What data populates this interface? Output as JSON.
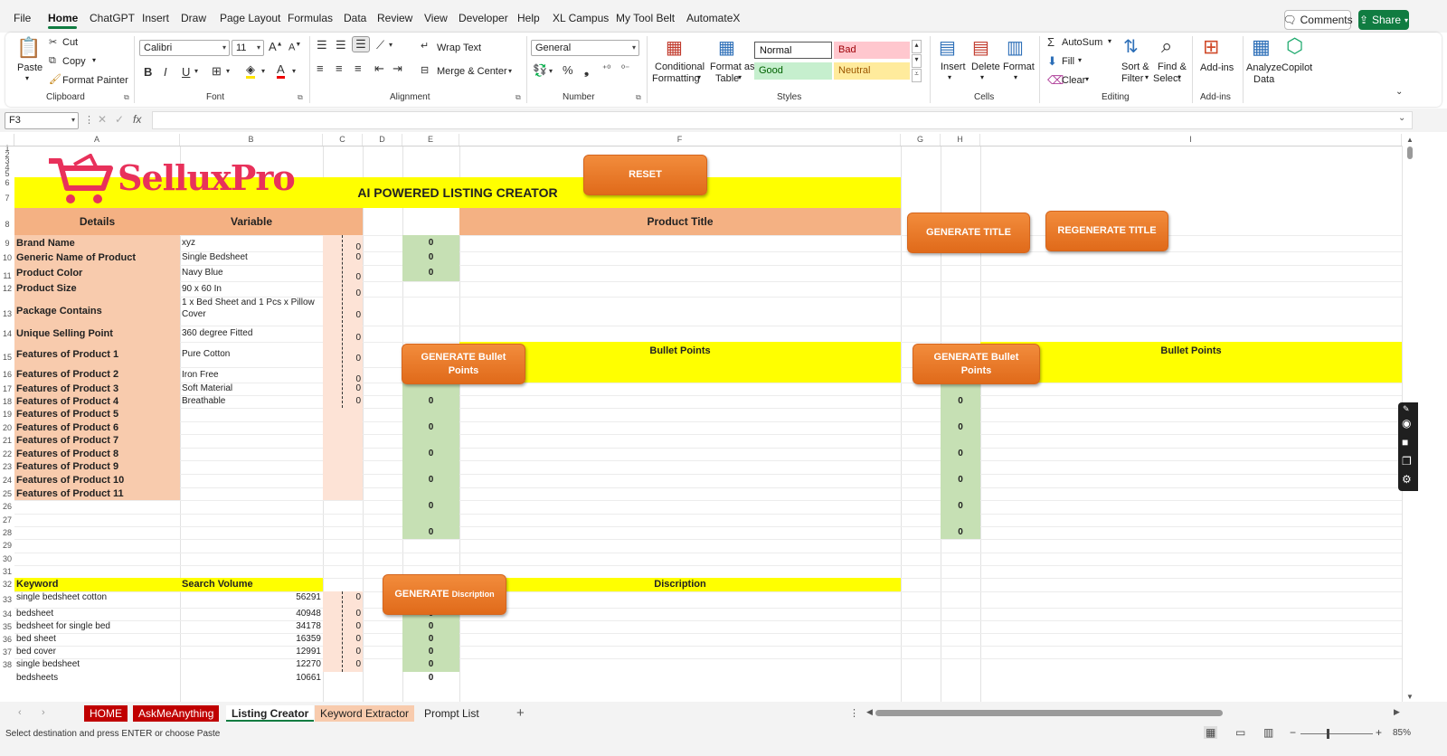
{
  "menu": {
    "items": [
      "File",
      "Home",
      "ChatGPT",
      "Insert",
      "Draw",
      "Page Layout",
      "Formulas",
      "Data",
      "Review",
      "View",
      "Developer",
      "Help",
      "XL Campus",
      "My Tool Belt",
      "AutomateX"
    ],
    "comments": "Comments",
    "share": "Share"
  },
  "ribbon": {
    "clipboard": {
      "paste": "Paste",
      "cut": "Cut",
      "copy": "Copy",
      "format_painter": "Format Painter",
      "group": "Clipboard"
    },
    "font": {
      "name": "Calibri",
      "size": "11",
      "group": "Font"
    },
    "alignment": {
      "wrap": "Wrap Text",
      "merge": "Merge & Center",
      "group": "Alignment"
    },
    "number": {
      "format": "General",
      "group": "Number"
    },
    "styles": {
      "conditional": [
        "Conditional",
        "Formatting"
      ],
      "format_table": [
        "Format as",
        "Table"
      ],
      "normal": "Normal",
      "bad": "Bad",
      "good": "Good",
      "neutral": "Neutral",
      "group": "Styles"
    },
    "cells": {
      "insert": "Insert",
      "delete": "Delete",
      "format": "Format",
      "group": "Cells"
    },
    "editing": {
      "autosum": "AutoSum",
      "fill": "Fill",
      "clear": "Clear",
      "sort": [
        "Sort &",
        "Filter"
      ],
      "find": [
        "Find &",
        "Select"
      ],
      "group": "Editing"
    },
    "addins": {
      "addins": "Add-ins",
      "group": "Add-ins"
    },
    "analyze": [
      "Analyze",
      "Data"
    ],
    "copilot": "Copilot"
  },
  "formula": {
    "name_box": "F3",
    "fx": "fx"
  },
  "columns": [
    "A",
    "B",
    "C",
    "D",
    "E",
    "F",
    "G",
    "H",
    "I"
  ],
  "logo": "SelluxPro",
  "buttons": {
    "reset": "RESET",
    "gen_title": "GENERATE TITLE",
    "regen_title": "REGENERATE TITLE",
    "gen_bullets": "GENERATE Bullet Points",
    "gen_bullets2": "GENERATE Bullet Points",
    "gen_desc_big": "GENERATE",
    "gen_desc_small": "Discription"
  },
  "banner": "AI POWERED LISTING CREATOR",
  "headers": {
    "details": "Details",
    "variable": "Variable",
    "product_title": "Product Title",
    "bullet_points": "Bullet Points",
    "bullet_points2": "Bullet Points",
    "keyword": "Keyword",
    "search_volume": "Search Volume",
    "discription": "Discription"
  },
  "details": [
    {
      "label": "Brand Name",
      "value": "xyz",
      "c": "0",
      "e": "0"
    },
    {
      "label": "Generic Name of Product",
      "value": "Single Bedsheet",
      "c": "0",
      "e": "0"
    },
    {
      "label": "Product Color",
      "value": "Navy Blue",
      "c": "0",
      "e": "0"
    },
    {
      "label": "Product Size",
      "value": "90 x 60 In",
      "c": "0",
      "e": ""
    },
    {
      "label": "Package Contains",
      "value": "1 x Bed Sheet and 1 Pcs x Pillow Cover",
      "c": "0",
      "e": ""
    },
    {
      "label": "Unique Selling Point",
      "value": "360 degree Fitted",
      "c": "0",
      "e": ""
    },
    {
      "label": "Features of Product 1",
      "value": "Pure Cotton",
      "c": "0",
      "e": ""
    },
    {
      "label": "Features of Product 2",
      "value": "Iron Free",
      "c": "0",
      "e": ""
    },
    {
      "label": "Features of Product 3",
      "value": "Soft Material",
      "c": "0",
      "e": ""
    },
    {
      "label": "Features of Product 4",
      "value": "Breathable",
      "c": "0",
      "e": ""
    },
    {
      "label": "Features of Product 5",
      "value": "",
      "c": "",
      "e": ""
    },
    {
      "label": "Features of Product 6",
      "value": "",
      "c": "",
      "e": ""
    },
    {
      "label": "Features of Product 7",
      "value": "",
      "c": "",
      "e": ""
    },
    {
      "label": "Features of Product 8",
      "value": "",
      "c": "",
      "e": ""
    },
    {
      "label": "Features of Product 9",
      "value": "",
      "c": "",
      "e": ""
    },
    {
      "label": "Features of Product 10",
      "value": "",
      "c": "",
      "e": ""
    },
    {
      "label": "Features of Product 11",
      "value": "",
      "c": "",
      "e": ""
    }
  ],
  "keywords": [
    {
      "keyword": "single bedsheet cotton",
      "volume": "56291",
      "c": "0",
      "e": "0"
    },
    {
      "keyword": "bedsheet",
      "volume": "40948",
      "c": "0",
      "e": "0"
    },
    {
      "keyword": "bedsheet for single bed",
      "volume": "34178",
      "c": "0",
      "e": "0"
    },
    {
      "keyword": "bed sheet",
      "volume": "16359",
      "c": "0",
      "e": "0"
    },
    {
      "keyword": "bed cover",
      "volume": "12991",
      "c": "0",
      "e": "0"
    },
    {
      "keyword": "single bedsheet",
      "volume": "12270",
      "c": "0",
      "e": "0"
    },
    {
      "keyword": "bedsheets",
      "volume": "10661",
      "c": "",
      "e": "0"
    }
  ],
  "bullet_zeros": [
    "0",
    "0",
    "0",
    "0",
    "0",
    "0",
    "0"
  ],
  "sheets": [
    {
      "name": "HOME",
      "bg": "#c00000",
      "fg": "#ffffff"
    },
    {
      "name": "AskMeAnything",
      "bg": "#c00000",
      "fg": "#ffffff"
    },
    {
      "name": "Listing Creator",
      "bg": "#ffffff",
      "fg": "#222222"
    },
    {
      "name": "Keyword Extractor",
      "bg": "#f8cbad",
      "fg": "#222222"
    },
    {
      "name": "Prompt List",
      "bg": "transparent",
      "fg": "#222222"
    }
  ],
  "status": {
    "message": "Select destination and press ENTER or choose Paste",
    "zoom": "85%"
  }
}
